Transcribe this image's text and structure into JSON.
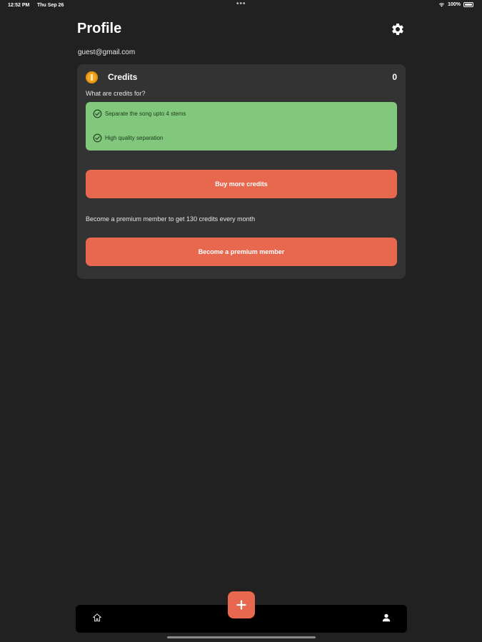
{
  "status_bar": {
    "time": "12:52 PM",
    "date": "Thu Sep 26",
    "dots": "•••",
    "battery_text": "100%"
  },
  "header": {
    "title": "Profile",
    "settings_icon": "gear-icon"
  },
  "account": {
    "email": "guest@gmail.com"
  },
  "credits": {
    "title": "Credits",
    "count": "0",
    "question": "What are credits for?",
    "features": [
      {
        "label": "Separate the song upto 4 stems"
      },
      {
        "label": "High quality separation"
      }
    ],
    "buy_label": "Buy more credits",
    "premium_text": "Become a premium member to get 130 credits every month",
    "premium_label": "Become a premium member"
  },
  "nav": {
    "home_icon": "home-icon",
    "add_icon": "plus-icon",
    "profile_icon": "person-icon"
  },
  "colors": {
    "background": "#212121",
    "card": "#333333",
    "accent": "#e8684f",
    "feature_bg": "#81c77c"
  }
}
